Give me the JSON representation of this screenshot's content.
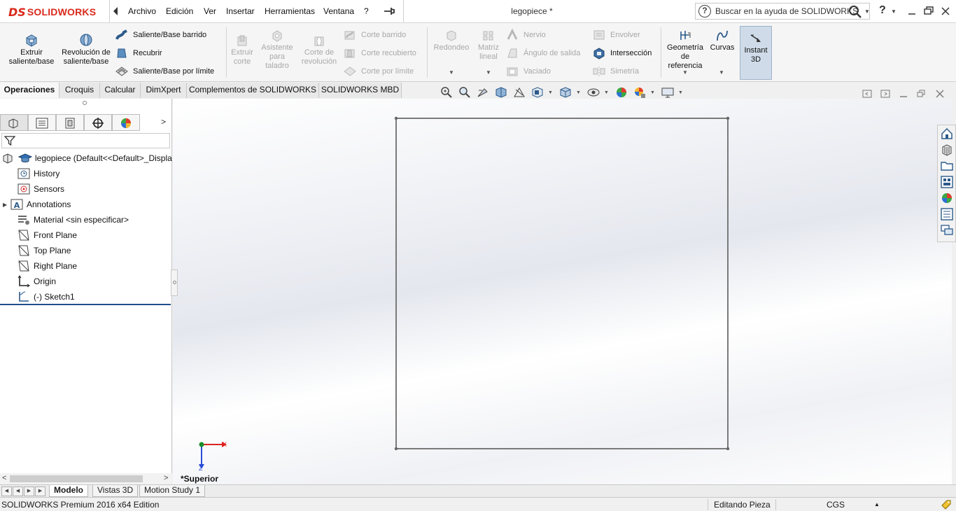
{
  "app": {
    "logo_mark": "DS",
    "logo_text": "SOLIDWORKS",
    "doc_title": "legopiece *"
  },
  "menu": [
    "Archivo",
    "Edición",
    "Ver",
    "Insertar",
    "Herramientas",
    "Ventana",
    "?"
  ],
  "search": {
    "placeholder": "Buscar en la ayuda de SOLIDWORKS"
  },
  "help_label": "?",
  "ribbon": {
    "extruir": "Extruir saliente/base",
    "revolucion": "Revolución de saliente/base",
    "barrido": "Saliente/Base barrido",
    "recubrir": "Recubrir",
    "limite": "Saliente/Base por límite",
    "extruir_corte": "Extruir corte",
    "asistente": "Asistente para taladro",
    "corte_revolucion": "Corte de revolución",
    "corte_barrido": "Corte barrido",
    "corte_recubierto": "Corte recubierto",
    "corte_limite": "Corte por límite",
    "redondeo": "Redondeo",
    "matriz": "Matriz lineal",
    "nervio": "Nervio",
    "angulo": "Ángulo de salida",
    "vaciado": "Vaciado",
    "envolver": "Envolver",
    "interseccion": "Intersección",
    "simetria": "Simetría",
    "geometria": "Geometría de referencia",
    "curvas": "Curvas",
    "instant3d": "Instant 3D"
  },
  "cm_tabs": [
    "Operaciones",
    "Croquis",
    "Calcular",
    "DimXpert",
    "Complementos de SOLIDWORKS",
    "SOLIDWORKS MBD"
  ],
  "tree": {
    "root": "legopiece  (Default<<Default>_Displa",
    "items": [
      "History",
      "Sensors",
      "Annotations",
      "Material <sin especificar>",
      "Front Plane",
      "Top Plane",
      "Right Plane",
      "Origin",
      "(-) Sketch1"
    ]
  },
  "graphics": {
    "view_name": "*Superior",
    "axis_x": "X",
    "axis_z": "Z"
  },
  "bottom_tabs": [
    "Modelo",
    "Vistas 3D",
    "Motion Study 1"
  ],
  "status": {
    "edition": "SOLIDWORKS Premium 2016 x64 Edition",
    "mode": "Editando Pieza",
    "units": "CGS",
    "units_arrow": "▲"
  },
  "colors": {
    "brand": "#da291c",
    "selection": "#1f4e8c",
    "instant3d_active": "#cfdbe8"
  },
  "icons": [
    "solidworks-logo",
    "pin-icon",
    "search-icon",
    "help-icon",
    "minimize-icon",
    "restore-icon",
    "close-icon",
    "home-icon",
    "folder-icon",
    "appearance-icon"
  ]
}
